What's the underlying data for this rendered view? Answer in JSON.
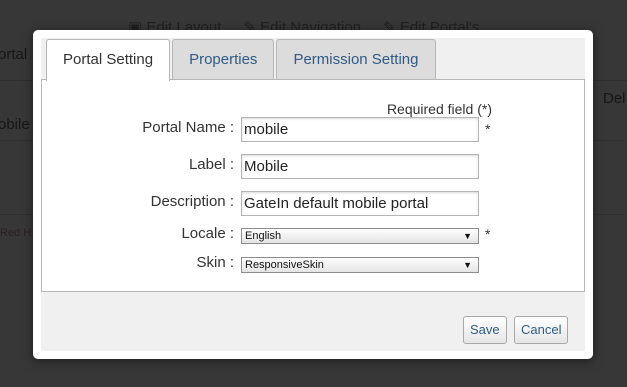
{
  "background": {
    "toolbar": [
      "Edit Layout",
      "Edit Navigation",
      "Edit Portal's"
    ],
    "left_texts": [
      "ortal",
      "obile"
    ],
    "right_text": "Del",
    "footer_text": "Red H"
  },
  "dialog": {
    "tabs": [
      {
        "label": "Portal Setting",
        "active": true
      },
      {
        "label": "Properties",
        "active": false
      },
      {
        "label": "Permission Setting",
        "active": false
      }
    ],
    "required_note": "Required field (*)",
    "fields": {
      "portal_name": {
        "label": "Portal Name :",
        "value": "mobile",
        "required": "*"
      },
      "label": {
        "label": "Label :",
        "value": "Mobile"
      },
      "description": {
        "label": "Description :",
        "value": "GateIn default mobile portal"
      },
      "locale": {
        "label": "Locale :",
        "value": "English",
        "required": "*"
      },
      "skin": {
        "label": "Skin :",
        "value": "ResponsiveSkin"
      }
    },
    "buttons": {
      "save": "Save",
      "cancel": "Cancel"
    }
  },
  "icons": {
    "dropdown": "caret-down-icon",
    "toolbar": "edit-icon"
  },
  "colors": {
    "tab_link": "#2f5b86",
    "dialog_bg": "#f0f0f0",
    "overlay": "#3a3a3a"
  }
}
